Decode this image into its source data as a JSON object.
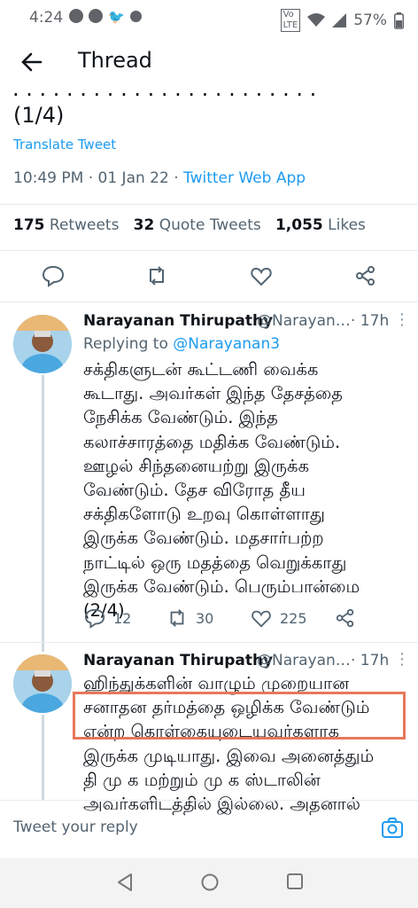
{
  "status_bar": {
    "time": "4:24",
    "battery": "57%"
  },
  "header": {
    "title": "Thread"
  },
  "main_tweet": {
    "text_tail": "(1/4)",
    "translate": "Translate Tweet",
    "timestamp": "10:49 PM · 01 Jan 22 · ",
    "source": "Twitter Web App",
    "retweets_count": "175",
    "retweets_label": "Retweets",
    "quotes_count": "32",
    "quotes_label": "Quote Tweets",
    "likes_count": "1,055",
    "likes_label": "Likes"
  },
  "reply1": {
    "name": "Narayanan Thirupathy",
    "handle": "@Narayan…",
    "time": "· 17h",
    "replying_prefix": "Replying to ",
    "replying_to": "@Narayanan3",
    "lines": [
      "சக்திகளுடன் கூட்டணி வைக்க",
      "கூடாது. அவர்கள் இந்த தேசத்தை",
      "நேசிக்க வேண்டும். இந்த",
      "கலாச்சாரத்தை மதிக்க வேண்டும்.",
      "ஊழல் சிந்தனையற்று இருக்க",
      "வேண்டும். தேச விரோத தீய",
      "சக்திகளோடு உறவு கொள்ளாது",
      "இருக்க வேண்டும். மதசார்பற்ற",
      "நாட்டில் ஒரு மதத்தை வெறுக்காது",
      "இருக்க வேண்டும். பெரும்பான்மை",
      "(2/4)"
    ],
    "replies": "12",
    "retweets": "30",
    "likes": "225"
  },
  "reply2": {
    "name": "Narayanan Thirupathy",
    "handle": "@Narayan…",
    "time": "· 17h",
    "lines": [
      "ஹிந்துக்களின் வாழும் முறையான",
      "சனாதன தர்மத்தை ஒழிக்க வேண்டும்",
      "என்ற கொள்கையுடையவர்களாக",
      "இருக்க முடியாது. இவை அனைத்தும்",
      "தி மு க மற்றும் மு க ஸ்டாலின்",
      "அவர்களிடத்தில் இல்லை. அதனால்"
    ]
  },
  "compose": {
    "placeholder": "Tweet your reply"
  },
  "colors": {
    "accent": "#1d9bf0",
    "highlight": "#e8775c"
  }
}
